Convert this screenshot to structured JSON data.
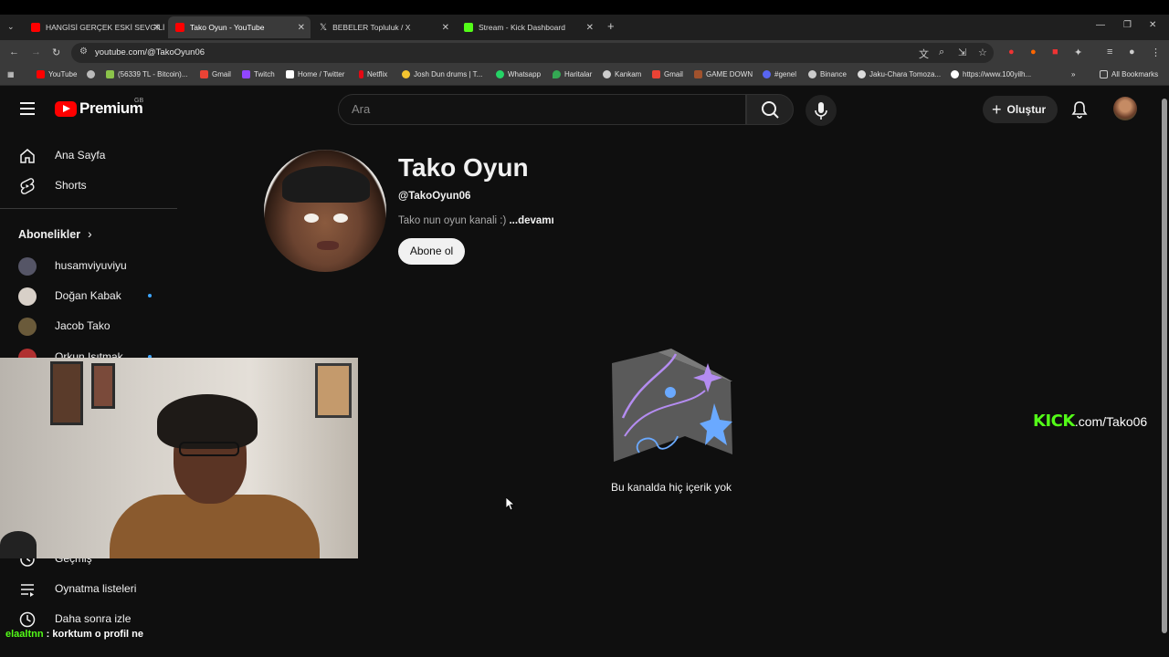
{
  "browser": {
    "tabs": [
      {
        "title": "HANGİSİ GERÇEK ESKİ SEVGİLİ",
        "favicon_color": "#ff0000"
      },
      {
        "title": "Tako Oyun - YouTube",
        "favicon_color": "#ff0000",
        "active": true
      },
      {
        "title": "BEBELER Topluluk / X",
        "favicon_color": "#ffffff"
      },
      {
        "title": "Stream - Kick Dashboard",
        "favicon_color": "#53fc18"
      }
    ],
    "url": "youtube.com/@TakoOyun06",
    "bookmarks": [
      {
        "label": "YouTube",
        "color": "#ff0000"
      },
      {
        "label": "",
        "color": "#bbbbbb"
      },
      {
        "label": "(56339 TL - Bitcoin)...",
        "color": "#8bc34a"
      },
      {
        "label": "Gmail",
        "color": "#ea4335"
      },
      {
        "label": "Twitch",
        "color": "#9146ff"
      },
      {
        "label": "Home / Twitter",
        "color": "#ffffff"
      },
      {
        "label": "Netflix",
        "color": "#e50914"
      },
      {
        "label": "Josh Dun drums | T...",
        "color": "#f4c430"
      },
      {
        "label": "Whatsapp",
        "color": "#25d366"
      },
      {
        "label": "Haritalar",
        "color": "#34a853"
      },
      {
        "label": "Kankam",
        "color": "#cccccc"
      },
      {
        "label": "Gmail",
        "color": "#ea4335"
      },
      {
        "label": "GAME DOWN",
        "color": "#a0522d"
      },
      {
        "label": "#genel",
        "color": "#5865f2"
      },
      {
        "label": "Binance",
        "color": "#cccccc"
      },
      {
        "label": "Jaku-Chara Tomoza...",
        "color": "#dddddd"
      },
      {
        "label": "https://www.100yilh...",
        "color": "#ffffff"
      }
    ],
    "all_bookmarks": "All Bookmarks"
  },
  "masthead": {
    "brand": "Premium",
    "region": "GB",
    "search_placeholder": "Ara",
    "create_label": "Oluştur"
  },
  "sidebar": {
    "items": [
      {
        "label": "Ana Sayfa",
        "icon": "home-icon"
      },
      {
        "label": "Shorts",
        "icon": "shorts-icon"
      }
    ],
    "subscriptions_title": "Abonelikler",
    "subscriptions": [
      {
        "label": "husamviyuviyu",
        "color": "#555566",
        "new": false
      },
      {
        "label": "Doğan Kabak",
        "color": "#d8d0c8",
        "new": true
      },
      {
        "label": "Jacob Tako",
        "color": "#6a5a3a",
        "new": false
      },
      {
        "label": "Orkun Işıtmak",
        "color": "#b03030",
        "new": true
      }
    ],
    "bottom_items": [
      {
        "label": "Geçmiş",
        "icon": "history-icon"
      },
      {
        "label": "Oynatma listeleri",
        "icon": "playlists-icon"
      },
      {
        "label": "Daha sonra izle",
        "icon": "watch-later-icon"
      }
    ]
  },
  "channel": {
    "name": "Tako Oyun",
    "handle": "@TakoOyun06",
    "description": "Tako nun oyun kanali :)",
    "more": "...devamı",
    "subscribe_label": "Abone ol",
    "empty_message": "Bu kanalda hiç içerik yok"
  },
  "overlay": {
    "kick_brand": "KICK",
    "kick_url": ".com/Tako06",
    "chat_user": "elaaltnn",
    "chat_sep": " : ",
    "chat_text": "korktum o profil ne"
  }
}
